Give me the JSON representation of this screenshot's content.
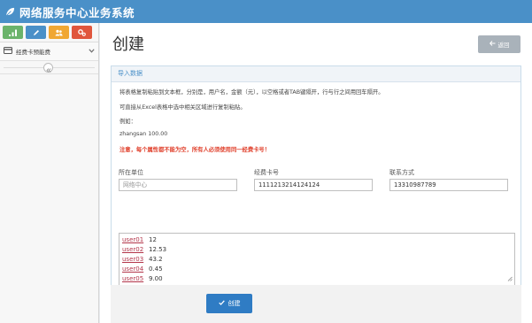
{
  "app": {
    "title": "网络服务中心业务系统"
  },
  "colors": {
    "header": "#4a90c8",
    "primary": "#2f7cc4",
    "warning": "#e0402c",
    "shortcut_green": "#6bb36b",
    "shortcut_blue": "#4a90c8",
    "shortcut_orange": "#f0a733",
    "shortcut_red": "#e0563d"
  },
  "sidebar": {
    "shortcuts": [
      {
        "icon": "signal-icon"
      },
      {
        "icon": "pencil-icon"
      },
      {
        "icon": "users-icon"
      },
      {
        "icon": "cogs-icon"
      }
    ],
    "menu": [
      {
        "label": "经费卡预能费",
        "icon": "credit-card-icon"
      }
    ]
  },
  "page": {
    "title": "创建",
    "back_label": "返回"
  },
  "panel": {
    "title": "导入数据",
    "instructions": [
      "将表格复制粘贴到文本框，分别是，用户名，金额（元），以空格或者TAB键隔开，行与行之间用回车隔开。",
      "可直接从Excel表格中选中相关区域进行复制粘贴。",
      "例如：",
      "zhangsan 100.00"
    ],
    "warning": "注意，每个属性都不能为空，所有人必须使用同一经费卡号！"
  },
  "form": {
    "unit": {
      "label": "所在单位",
      "value": "网络中心"
    },
    "card": {
      "label": "经费卡号",
      "value": "1111213214124124"
    },
    "contact": {
      "label": "联系方式",
      "value": "13310987789"
    }
  },
  "paste_rows": [
    {
      "user": "user01",
      "amount": "12"
    },
    {
      "user": "user02",
      "amount": "12.53"
    },
    {
      "user": "user03",
      "amount": "43.2"
    },
    {
      "user": "user04",
      "amount": "0.45"
    },
    {
      "user": "user05",
      "amount": "9.00"
    }
  ],
  "actions": {
    "create_label": "创建"
  }
}
